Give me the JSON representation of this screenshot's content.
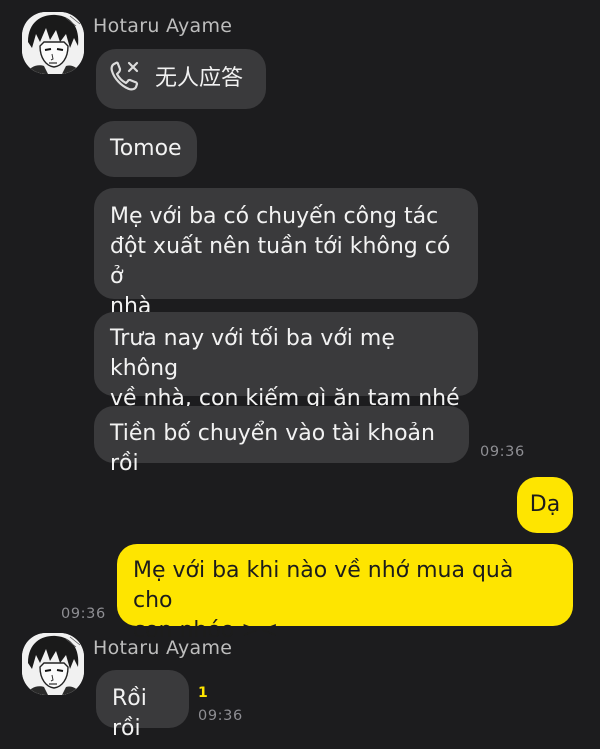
{
  "conversation": {
    "group1": {
      "sender": "Hotaru Ayame",
      "avatar_icon": "manga-portrait-avatar",
      "messages": [
        {
          "type": "missed-call",
          "icon": "missed-call-icon",
          "text": "无人应答"
        },
        {
          "type": "text",
          "text": "Tomoe"
        },
        {
          "type": "text",
          "text": "Mẹ với ba có chuyến công tác\nđột xuất nên tuần tới không có ở\nnhà"
        },
        {
          "type": "text",
          "text": "Trưa nay với tối ba với mẹ không\nvề nhà,  con kiếm gì ăn tạm nhé"
        },
        {
          "type": "text",
          "text": "Tiền bố chuyển vào tài khoản rồi"
        }
      ],
      "time": "09:36"
    },
    "mine": {
      "messages": [
        {
          "text": "Dạ"
        },
        {
          "text": "Mẹ với ba khi nào về nhớ mua quà cho\ncon nhóo ><"
        }
      ],
      "time": "09:36"
    },
    "group2": {
      "sender": "Hotaru Ayame",
      "avatar_icon": "manga-portrait-avatar",
      "messages": [
        {
          "type": "text",
          "text": "Rồi rồi",
          "unread_count": "1"
        }
      ],
      "time": "09:36"
    }
  },
  "colors": {
    "background": "#1c1c1e",
    "incoming_bubble": "#3a3a3c",
    "outgoing_bubble": "#fee500",
    "timestamp": "#8e8e93",
    "unread": "#fee500"
  }
}
